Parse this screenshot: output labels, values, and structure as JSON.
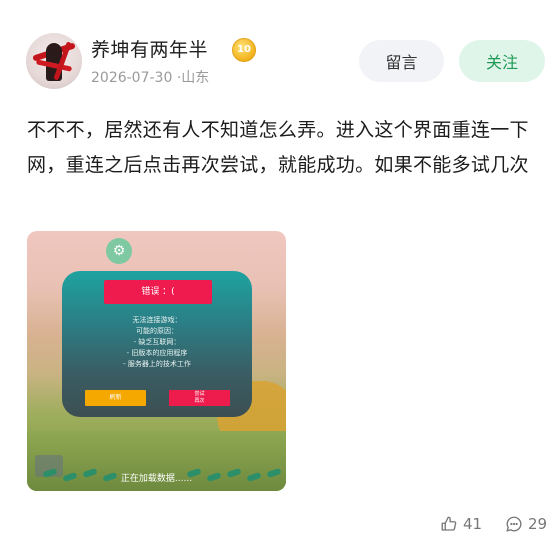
{
  "author": {
    "name": "养坤有两年半",
    "level": "10",
    "date": "2026-07-30",
    "location": "·山东"
  },
  "actions": {
    "comment_label": "留言",
    "follow_label": "关注"
  },
  "post": {
    "text": "不不不，居然还有人不知道怎么弄。进入这个界面重连一下网，重连之后点击再次尝试，就能成功。如果不能多试几次"
  },
  "screenshot": {
    "error_title": "错误 ：(",
    "error_lines": [
      "无法连接游戏：",
      "可能的原因：",
      "- 缺乏互联网：",
      "- 旧版本的应用程序",
      "- 服务器上的技术工作"
    ],
    "refresh_label": "刷新",
    "retry_label_1": "尝试",
    "retry_label_2": "再次",
    "loading_text": "正在加载数据......"
  },
  "stats": {
    "likes": "41",
    "comments": "29"
  },
  "colors": {
    "follow_text": "#1f9a55",
    "follow_bg": "#dff5e9",
    "error_red": "#ef1a4e",
    "refresh_orange": "#f5a800"
  }
}
